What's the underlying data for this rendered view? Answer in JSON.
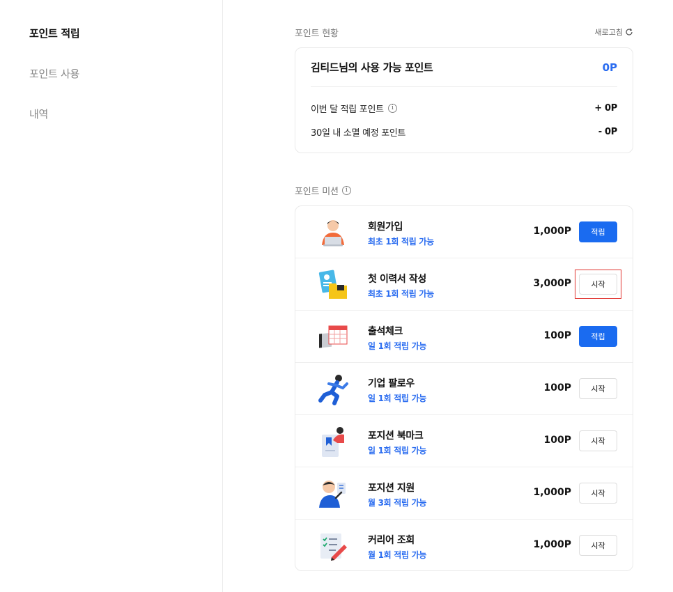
{
  "sidebar": {
    "items": [
      {
        "label": "포인트 적립",
        "active": true
      },
      {
        "label": "포인트 사용",
        "active": false
      },
      {
        "label": "내역",
        "active": false
      }
    ]
  },
  "status": {
    "title": "포인트 현황",
    "refresh_label": "새로고침",
    "available_label": "김티드님의 사용 가능 포인트",
    "available_value": "0P",
    "monthly_label": "이번 달 적립 포인트",
    "monthly_value": "+ 0P",
    "expiring_label": "30일 내 소멸 예정 포인트",
    "expiring_value": "- 0P"
  },
  "missions": {
    "title": "포인트 미션",
    "items": [
      {
        "icon": "laptop-person-icon",
        "name": "회원가입",
        "sub": "최초 1회 적립 가능",
        "points": "1,000P",
        "button": "적립",
        "button_style": "primary"
      },
      {
        "icon": "resume-folder-icon",
        "name": "첫 이력서 작성",
        "sub": "최초 1회 적립 가능",
        "points": "3,000P",
        "button": "시작",
        "button_style": "outline",
        "highlighted": true
      },
      {
        "icon": "calendar-icon",
        "name": "출석체크",
        "sub": "일 1회 적립 가능",
        "points": "100P",
        "button": "적립",
        "button_style": "primary"
      },
      {
        "icon": "running-person-icon",
        "name": "기업 팔로우",
        "sub": "일 1회 적립 가능",
        "points": "100P",
        "button": "시작",
        "button_style": "outline"
      },
      {
        "icon": "bookmark-person-icon",
        "name": "포지션 북마크",
        "sub": "일 1회 적립 가능",
        "points": "100P",
        "button": "시작",
        "button_style": "outline"
      },
      {
        "icon": "person-apply-icon",
        "name": "포지션 지원",
        "sub": "월 3회 적립 가능",
        "points": "1,000P",
        "button": "시작",
        "button_style": "outline"
      },
      {
        "icon": "checklist-pencil-icon",
        "name": "커리어 조회",
        "sub": "월 1회 적립 가능",
        "points": "1,000P",
        "button": "시작",
        "button_style": "outline"
      }
    ]
  },
  "colors": {
    "accent": "#1a6bf0",
    "accent_text": "#2a6cf0",
    "highlight": "#e0302c"
  }
}
